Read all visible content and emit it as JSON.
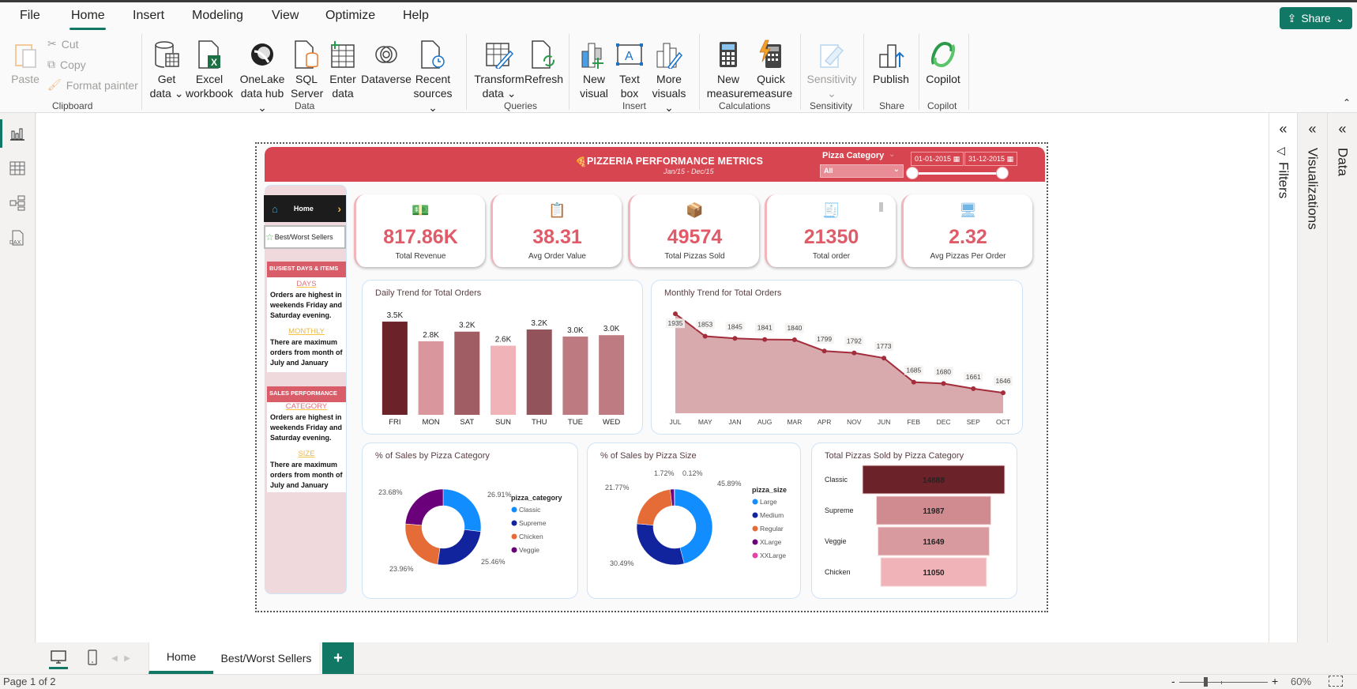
{
  "menu": {
    "tabs": [
      "File",
      "Home",
      "Insert",
      "Modeling",
      "View",
      "Optimize",
      "Help"
    ],
    "active": "Home",
    "share_label": "Share"
  },
  "ribbon": {
    "clipboard": {
      "paste": "Paste",
      "cut": "Cut",
      "copy": "Copy",
      "format_painter": "Format painter",
      "label": "Clipboard"
    },
    "data": {
      "label": "Data",
      "buttons": [
        {
          "l1": "Get",
          "l2": "data ⌄"
        },
        {
          "l1": "Excel",
          "l2": "workbook"
        },
        {
          "l1": "OneLake",
          "l2": "data hub ⌄"
        },
        {
          "l1": "SQL",
          "l2": "Server"
        },
        {
          "l1": "Enter",
          "l2": "data"
        },
        {
          "l1": "Dataverse",
          "l2": ""
        },
        {
          "l1": "Recent",
          "l2": "sources ⌄"
        }
      ]
    },
    "queries": {
      "label": "Queries",
      "transform_l1": "Transform",
      "transform_l2": "data ⌄",
      "refresh": "Refresh"
    },
    "insert": {
      "label": "Insert",
      "new_visual_l1": "New",
      "new_visual_l2": "visual",
      "text_box_l1": "Text",
      "text_box_l2": "box",
      "more_visuals_l1": "More",
      "more_visuals_l2": "visuals ⌄"
    },
    "calculations": {
      "label": "Calculations",
      "new_measure_l1": "New",
      "new_measure_l2": "measure",
      "quick_measure_l1": "Quick",
      "quick_measure_l2": "measure"
    },
    "sensitivity": {
      "label": "Sensitivity",
      "button": "Sensitivity",
      "chev": "⌄"
    },
    "share": {
      "label": "Share",
      "publish": "Publish"
    },
    "copilot": {
      "label": "Copilot",
      "button": "Copilot"
    }
  },
  "panes": {
    "filters": "Filters",
    "visualizations": "Visualizations",
    "data": "Data"
  },
  "report": {
    "title": "PIZZERIA PERFORMANCE METRICS",
    "subtitle": "Jan/15 - Dec/15",
    "slicer": {
      "label": "Pizza Category",
      "value": "All",
      "start_date": "01-01-2015",
      "end_date": "31-12-2015"
    },
    "nav": {
      "home": "Home",
      "best_worst": "Best/Worst Sellers"
    },
    "insights": [
      {
        "header": "BUSIEST DAYS & ITEMS",
        "items": [
          {
            "title": "DAYS",
            "color": "#e0707a",
            "text": "Orders are highest in weekends Friday and Saturday evening."
          },
          {
            "title": "MONTHLY",
            "color": "#e8b84a",
            "text": "There are maximum orders from month of July and January"
          }
        ]
      },
      {
        "header": "SALES PERFORMANCE",
        "items": [
          {
            "title": "CATEGORY",
            "color": "#e0707a",
            "text": "Orders are highest in weekends Friday and Saturday evening."
          },
          {
            "title": "SIZE",
            "color": "#e8b84a",
            "text": "There are maximum orders from month of July and January"
          }
        ]
      }
    ],
    "kpis": [
      {
        "value": "817.86K",
        "label": "Total Revenue",
        "icon": "money-icon"
      },
      {
        "value": "38.31",
        "label": "Avg Order Value",
        "icon": "clipboard-icon"
      },
      {
        "value": "49574",
        "label": "Total Pizzas Sold",
        "icon": "delivery-icon"
      },
      {
        "value": "21350",
        "label": "Total order",
        "icon": "receipt-icon"
      },
      {
        "value": "2.32",
        "label": "Avg Pizzas Per Order",
        "icon": "monitor-icon"
      }
    ]
  },
  "chart_data": [
    {
      "type": "bar",
      "title": "Daily Trend for Total Orders",
      "categories": [
        "FRI",
        "MON",
        "SAT",
        "SUN",
        "THU",
        "TUE",
        "WED"
      ],
      "values": [
        3538,
        2794,
        3158,
        2624,
        3239,
        2973,
        3024
      ],
      "labels": [
        "3.5K",
        "2.8K",
        "3.2K",
        "2.6K",
        "3.2K",
        "3.0K",
        "3.0K"
      ],
      "colors": [
        "#6b2229",
        "#d9979d",
        "#a05d64",
        "#efb3b8",
        "#93535a",
        "#be7a81",
        "#bf7b82"
      ],
      "ylim": [
        0,
        3600
      ]
    },
    {
      "type": "area",
      "title": "Monthly Trend for Total Orders",
      "categories": [
        "JUL",
        "MAY",
        "JAN",
        "AUG",
        "MAR",
        "APR",
        "NOV",
        "JUN",
        "FEB",
        "DEC",
        "SEP",
        "OCT"
      ],
      "values": [
        1935,
        1853,
        1845,
        1841,
        1840,
        1799,
        1792,
        1773,
        1685,
        1680,
        1661,
        1646
      ],
      "ylim": [
        1600,
        1950
      ],
      "line_color": "#a32d3a",
      "fill_color": "#d8a9ad"
    },
    {
      "type": "pie",
      "title": "% of Sales by Pizza Category",
      "legend_title": "pizza_category",
      "labels": [
        "Classic",
        "Supreme",
        "Chicken",
        "Veggie"
      ],
      "values": [
        26.91,
        25.46,
        23.96,
        23.68
      ],
      "value_labels": [
        "26.91%",
        "25.46%",
        "23.96%",
        "23.68%"
      ],
      "colors": [
        "#118dff",
        "#12239e",
        "#e66c37",
        "#6b007b"
      ],
      "legend": "right"
    },
    {
      "type": "pie",
      "title": "% of Sales by Pizza Size",
      "legend_title": "pizza_size",
      "labels": [
        "Large",
        "Medium",
        "Regular",
        "XLarge",
        "XXLarge"
      ],
      "values": [
        45.89,
        30.49,
        21.77,
        1.72,
        0.12
      ],
      "value_labels": [
        "45.89%",
        "30.49%",
        "21.77%",
        "1.72%",
        "0.12%"
      ],
      "colors": [
        "#118dff",
        "#12239e",
        "#e66c37",
        "#6b007b",
        "#e044a7"
      ],
      "legend": "right"
    },
    {
      "type": "bar",
      "orientation": "funnel",
      "title": "Total Pizzas Sold by Pizza Category",
      "categories": [
        "Classic",
        "Supreme",
        "Veggie",
        "Chicken"
      ],
      "values": [
        14888,
        11987,
        11649,
        11050
      ],
      "colors": [
        "#6b2229",
        "#d08b91",
        "#d99a9f",
        "#efb3b8"
      ]
    }
  ],
  "pages": {
    "tabs": [
      "Home",
      "Best/Worst Sellers"
    ],
    "active": "Home",
    "add": "+"
  },
  "status": {
    "page": "Page 1 of 2",
    "zoom": "60%",
    "zoom_fraction": 0.6
  }
}
